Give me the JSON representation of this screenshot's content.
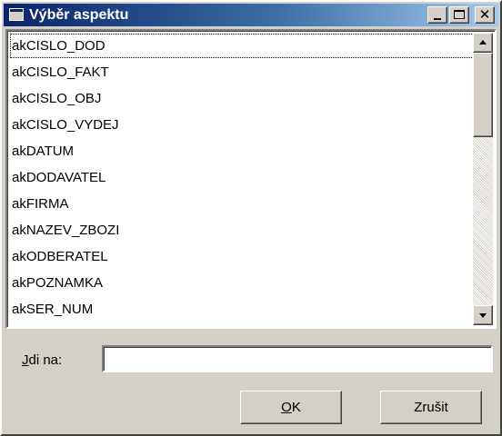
{
  "window": {
    "title": "Výběr aspektu",
    "controls": {
      "minimize": "minimize-icon",
      "maximize": "maximize-icon",
      "close": "close-icon"
    }
  },
  "list": {
    "items": [
      "akCISLO_DOD",
      "akCISLO_FAKT",
      "akCISLO_OBJ",
      "akCISLO_VYDEJ",
      "akDATUM",
      "akDODAVATEL",
      "akFIRMA",
      "akNAZEV_ZBOZI",
      "akODBERATEL",
      "akPOZNAMKA",
      "akSER_NUM"
    ],
    "focused_index": 0
  },
  "goto": {
    "label_accel": "J",
    "label_rest": "di na:",
    "value": ""
  },
  "buttons": {
    "ok_accel": "O",
    "ok_rest": "K",
    "cancel": "Zrušit"
  },
  "colors": {
    "titlebar_start": "#0a246a",
    "titlebar_end": "#a6caf0",
    "face": "#d4d0c8"
  }
}
